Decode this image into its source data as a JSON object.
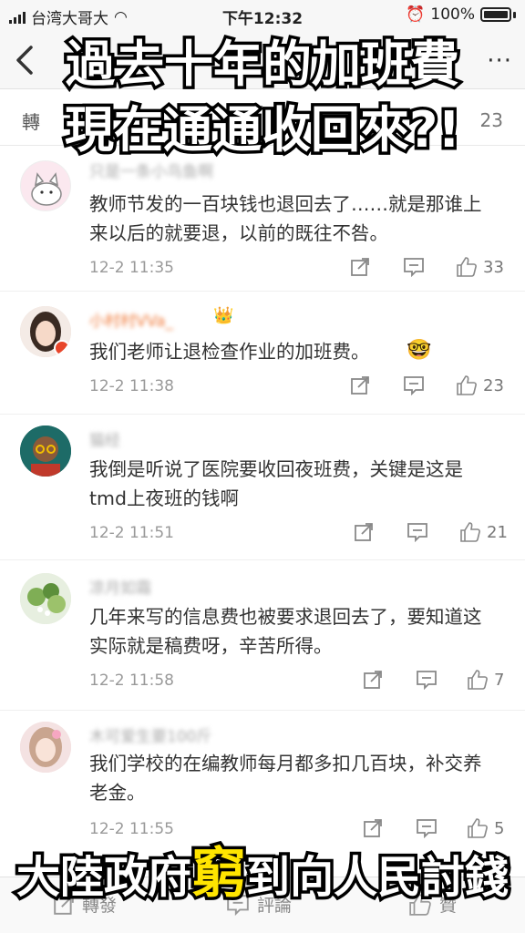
{
  "status_bar": {
    "carrier": "台湾大哥大",
    "time": "下午12:32",
    "battery": "100%"
  },
  "nav": {
    "more_label": "···"
  },
  "tabs": {
    "repost_label": "轉",
    "likes_count": "23"
  },
  "overlay": {
    "top_line1": "過去十年的加班費",
    "top_line2": "現在通通收回來?!",
    "bottom_pre": "大陸政府",
    "bottom_highlight": "窮",
    "bottom_post": "到向人民討錢"
  },
  "comments": [
    {
      "username": "只是一条小鸟鱼啊",
      "text": "教师节发的一百块钱也退回去了……就是那谁上来以后的就要退，以前的既往不咎。",
      "time": "12-2 11:35",
      "likes": "33"
    },
    {
      "username": "小村村VVa_",
      "text": "我们老师让退检查作业的加班费。",
      "time": "12-2 11:38",
      "likes": "23"
    },
    {
      "username": "猫经",
      "text": "我倒是听说了医院要收回夜班费，关键是这是tmd上夜班的钱啊",
      "time": "12-2 11:51",
      "likes": "21"
    },
    {
      "username": "凉月如霜",
      "text": "几年来写的信息费也被要求退回去了，要知道这实际就是稿费呀，辛苦所得。",
      "time": "12-2 11:58",
      "likes": "7"
    },
    {
      "username": "木可爱生要100斤",
      "text": "我们学校的在编教师每月都多扣几百块，补交养老金。",
      "time": "12-2 11:55",
      "likes": "5"
    }
  ],
  "toolbar": {
    "repost": "轉發",
    "comment": "評論",
    "like": "贊"
  }
}
